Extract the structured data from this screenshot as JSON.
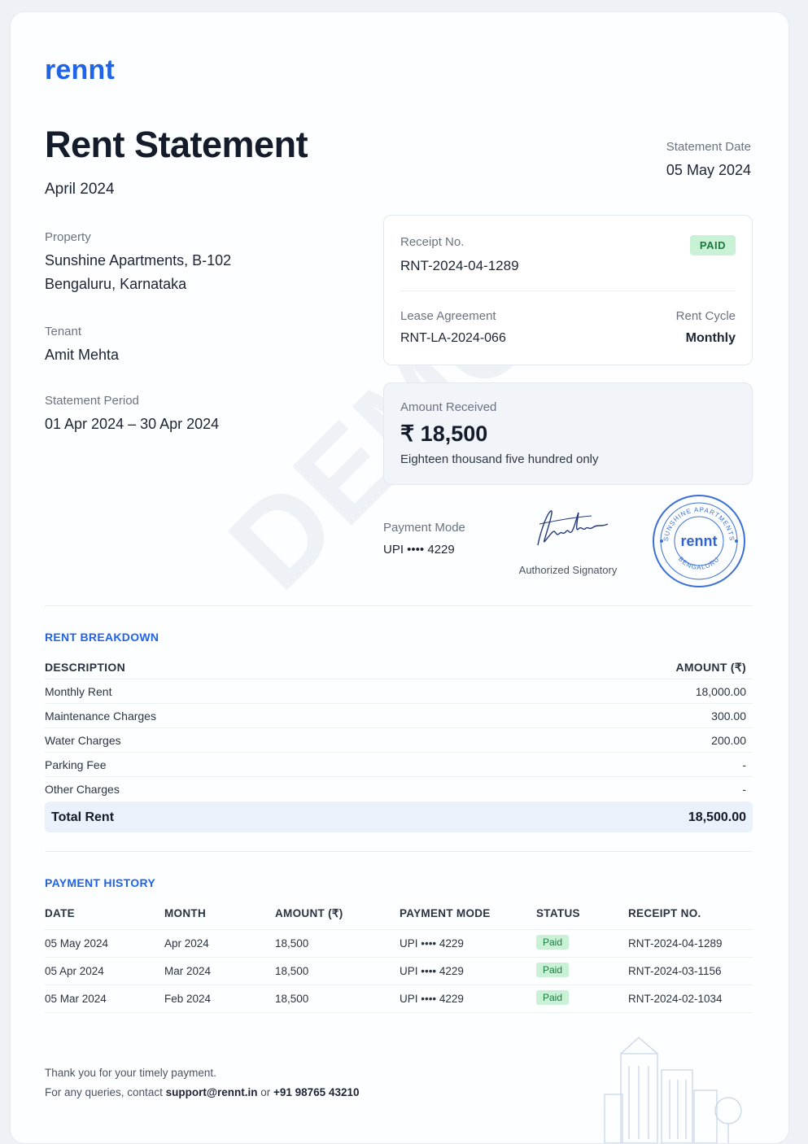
{
  "brand": {
    "logo": "rennt",
    "accent": "#1f63e6"
  },
  "header": {
    "title": "Rent Statement",
    "month": "April 2024",
    "statement_date_label": "Statement Date",
    "statement_date": "05 May 2024"
  },
  "property": {
    "label": "Property",
    "line1": "Sunshine Apartments, B-102",
    "line2": "Bengaluru, Karnataka"
  },
  "tenant": {
    "label": "Tenant",
    "name": "Amit Mehta"
  },
  "period": {
    "label": "Statement Period",
    "value": "01 Apr 2024 – 30 Apr 2024"
  },
  "receipt": {
    "label": "Receipt No.",
    "value": "RNT-2024-04-1289",
    "badge": "PAID",
    "lease_label": "Lease Agreement",
    "lease_value": "RNT-LA-2024-066",
    "cycle_label": "Rent Cycle",
    "cycle_value": "Monthly"
  },
  "amount": {
    "label": "Amount Received",
    "value": "₹ 18,500",
    "words": "Eighteen thousand five hundred only"
  },
  "payment_mode": {
    "label": "Payment Mode",
    "value": "UPI  •••• 4229"
  },
  "signatory": {
    "label": "Authorized Signatory"
  },
  "stamp": {
    "top_text": "SUNSHINE APARTMENTS",
    "center": "rennt",
    "bottom_text": "BENGALURU"
  },
  "watermark": "DEMO",
  "breakdown": {
    "title": "RENT BREAKDOWN",
    "col_desc": "DESCRIPTION",
    "col_amount": "AMOUNT (₹)",
    "rows": [
      {
        "desc": "Monthly Rent",
        "amount": "18,000.00"
      },
      {
        "desc": "Maintenance Charges",
        "amount": "300.00"
      },
      {
        "desc": "Water Charges",
        "amount": "200.00"
      },
      {
        "desc": "Parking Fee",
        "amount": "-"
      },
      {
        "desc": "Other Charges",
        "amount": "-"
      }
    ],
    "total_label": "Total Rent",
    "total_value": "18,500.00"
  },
  "history": {
    "title": "PAYMENT HISTORY",
    "headers": [
      "DATE",
      "MONTH",
      "AMOUNT (₹)",
      "PAYMENT MODE",
      "STATUS",
      "RECEIPT NO."
    ],
    "rows": [
      {
        "date": "05 May 2024",
        "month": "Apr 2024",
        "amount": "18,500",
        "mode": "UPI  •••• 4229",
        "status": "Paid",
        "receipt": "RNT-2024-04-1289"
      },
      {
        "date": "05 Apr 2024",
        "month": "Mar 2024",
        "amount": "18,500",
        "mode": "UPI  •••• 4229",
        "status": "Paid",
        "receipt": "RNT-2024-03-1156"
      },
      {
        "date": "05 Mar 2024",
        "month": "Feb 2024",
        "amount": "18,500",
        "mode": "UPI  •••• 4229",
        "status": "Paid",
        "receipt": "RNT-2024-02-1034"
      }
    ]
  },
  "footer": {
    "thanks": "Thank you for your timely payment.",
    "contact_prefix": "For any queries, contact ",
    "email": "support@rennt.in",
    "or": " or ",
    "phone": "+91 98765 43210"
  }
}
